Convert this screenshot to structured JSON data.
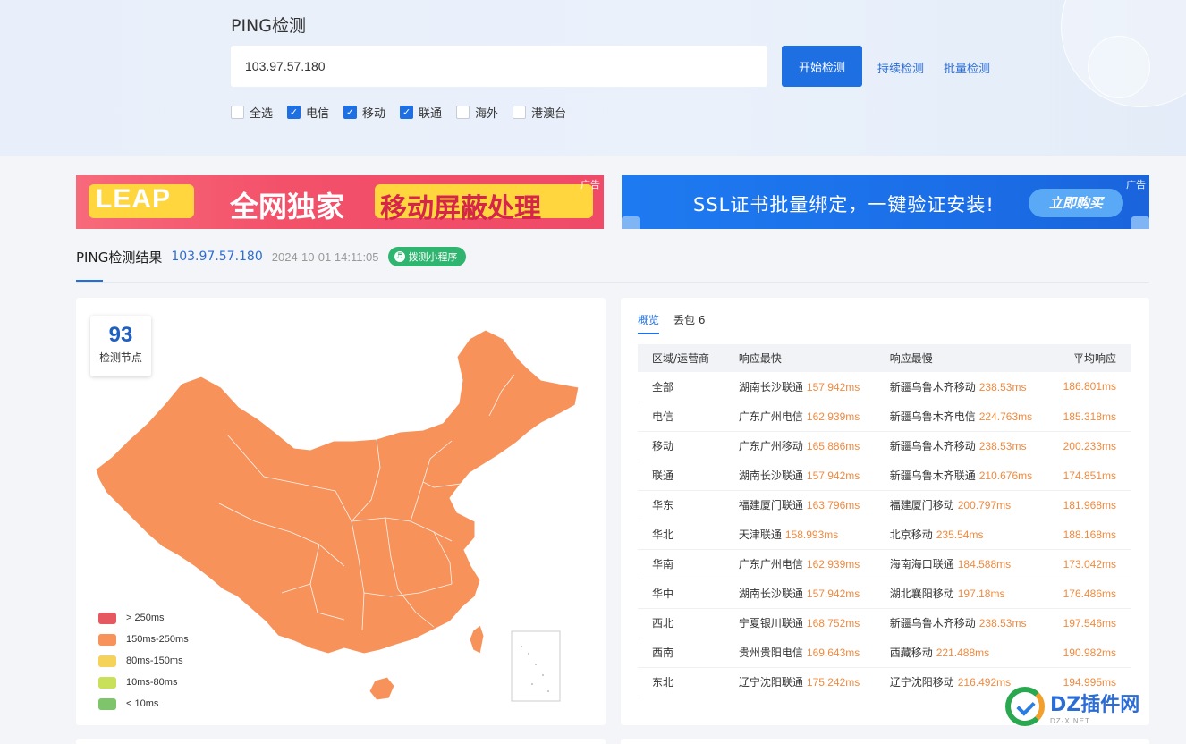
{
  "header": {
    "title": "PING检测",
    "search_value": "103.97.57.180",
    "start_button": "开始检测",
    "links": [
      "持续检测",
      "批量检测"
    ],
    "checkboxes": [
      {
        "label": "全选",
        "checked": false
      },
      {
        "label": "电信",
        "checked": true
      },
      {
        "label": "移动",
        "checked": true
      },
      {
        "label": "联通",
        "checked": true
      },
      {
        "label": "海外",
        "checked": false
      },
      {
        "label": "港澳台",
        "checked": false
      }
    ]
  },
  "ads": {
    "tag": "广告",
    "ad1": {
      "leap": "LEAP",
      "mid": "全网独家",
      "right": "移动屏蔽处理"
    },
    "ad2": {
      "text": "SSL证书批量绑定，一键验证安装!",
      "button": "立即购买"
    }
  },
  "result": {
    "title": "PING检测结果",
    "ip": "103.97.57.180",
    "time": "2024-10-01 14:11:05",
    "mini_program": "拨测小程序"
  },
  "map_panel": {
    "node_count": "93",
    "node_label": "检测节点",
    "fill_color": "#f7925a",
    "legend": [
      {
        "label": "> 250ms",
        "color": "#e6585f"
      },
      {
        "label": "150ms-250ms",
        "color": "#f7925a"
      },
      {
        "label": "80ms-150ms",
        "color": "#f5d25a"
      },
      {
        "label": "10ms-80ms",
        "color": "#c8e05a"
      },
      {
        "label": "< 10ms",
        "color": "#7dc46a"
      }
    ]
  },
  "stats_panel": {
    "tabs": [
      "概览",
      "丢包 6"
    ],
    "columns": [
      "区域/运营商",
      "响应最快",
      "响应最慢",
      "平均响应"
    ],
    "rows": [
      {
        "region": "全部",
        "fast": "湖南长沙联通",
        "fast_ms": "157.942ms",
        "slow": "新疆乌鲁木齐移动",
        "slow_ms": "238.53ms",
        "avg": "186.801ms"
      },
      {
        "region": "电信",
        "fast": "广东广州电信",
        "fast_ms": "162.939ms",
        "slow": "新疆乌鲁木齐电信",
        "slow_ms": "224.763ms",
        "avg": "185.318ms"
      },
      {
        "region": "移动",
        "fast": "广东广州移动",
        "fast_ms": "165.886ms",
        "slow": "新疆乌鲁木齐移动",
        "slow_ms": "238.53ms",
        "avg": "200.233ms"
      },
      {
        "region": "联通",
        "fast": "湖南长沙联通",
        "fast_ms": "157.942ms",
        "slow": "新疆乌鲁木齐联通",
        "slow_ms": "210.676ms",
        "avg": "174.851ms"
      },
      {
        "region": "华东",
        "fast": "福建厦门联通",
        "fast_ms": "163.796ms",
        "slow": "福建厦门移动",
        "slow_ms": "200.797ms",
        "avg": "181.968ms"
      },
      {
        "region": "华北",
        "fast": "天津联通",
        "fast_ms": "158.993ms",
        "slow": "北京移动",
        "slow_ms": "235.54ms",
        "avg": "188.168ms"
      },
      {
        "region": "华南",
        "fast": "广东广州电信",
        "fast_ms": "162.939ms",
        "slow": "海南海口联通",
        "slow_ms": "184.588ms",
        "avg": "173.042ms"
      },
      {
        "region": "华中",
        "fast": "湖南长沙联通",
        "fast_ms": "157.942ms",
        "slow": "湖北襄阳移动",
        "slow_ms": "197.18ms",
        "avg": "176.486ms"
      },
      {
        "region": "西北",
        "fast": "宁夏银川联通",
        "fast_ms": "168.752ms",
        "slow": "新疆乌鲁木齐移动",
        "slow_ms": "238.53ms",
        "avg": "197.546ms"
      },
      {
        "region": "西南",
        "fast": "贵州贵阳电信",
        "fast_ms": "169.643ms",
        "slow": "西藏移动",
        "slow_ms": "221.488ms",
        "avg": "190.982ms"
      },
      {
        "region": "东北",
        "fast": "辽宁沈阳联通",
        "fast_ms": "175.242ms",
        "slow": "辽宁沈阳移动",
        "slow_ms": "216.492ms",
        "avg": "194.995ms"
      }
    ]
  },
  "watermark": {
    "main": "DZ插件网",
    "sub": "DZ-X.NET"
  }
}
